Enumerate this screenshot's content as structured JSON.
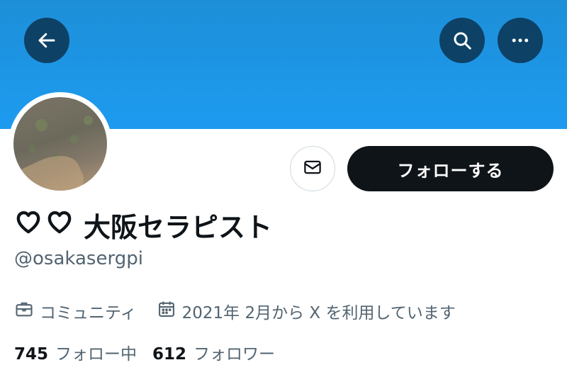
{
  "profile": {
    "display_name": "大阪セラピスト",
    "handle": "@osakasergpi",
    "category": "コミュニティ",
    "joined": "2021年 2月から X を利用しています"
  },
  "actions": {
    "follow_label": "フォローする"
  },
  "stats": {
    "following_count": "745",
    "following_label": "フォロー中",
    "followers_count": "612",
    "followers_label": "フォロワー"
  },
  "icons": {
    "back": "arrow-left-icon",
    "search": "search-icon",
    "more": "more-horizontal-icon",
    "message": "envelope-icon",
    "category": "briefcase-icon",
    "joined": "calendar-icon",
    "name_prefix": "heart-outline-icon"
  },
  "colors": {
    "banner": "#1d9bf0",
    "header_button_bg": "#0e4166",
    "primary_text": "#0f1419",
    "secondary_text": "#536471",
    "follow_button_bg": "#0f1419",
    "border": "#cfd9de"
  }
}
